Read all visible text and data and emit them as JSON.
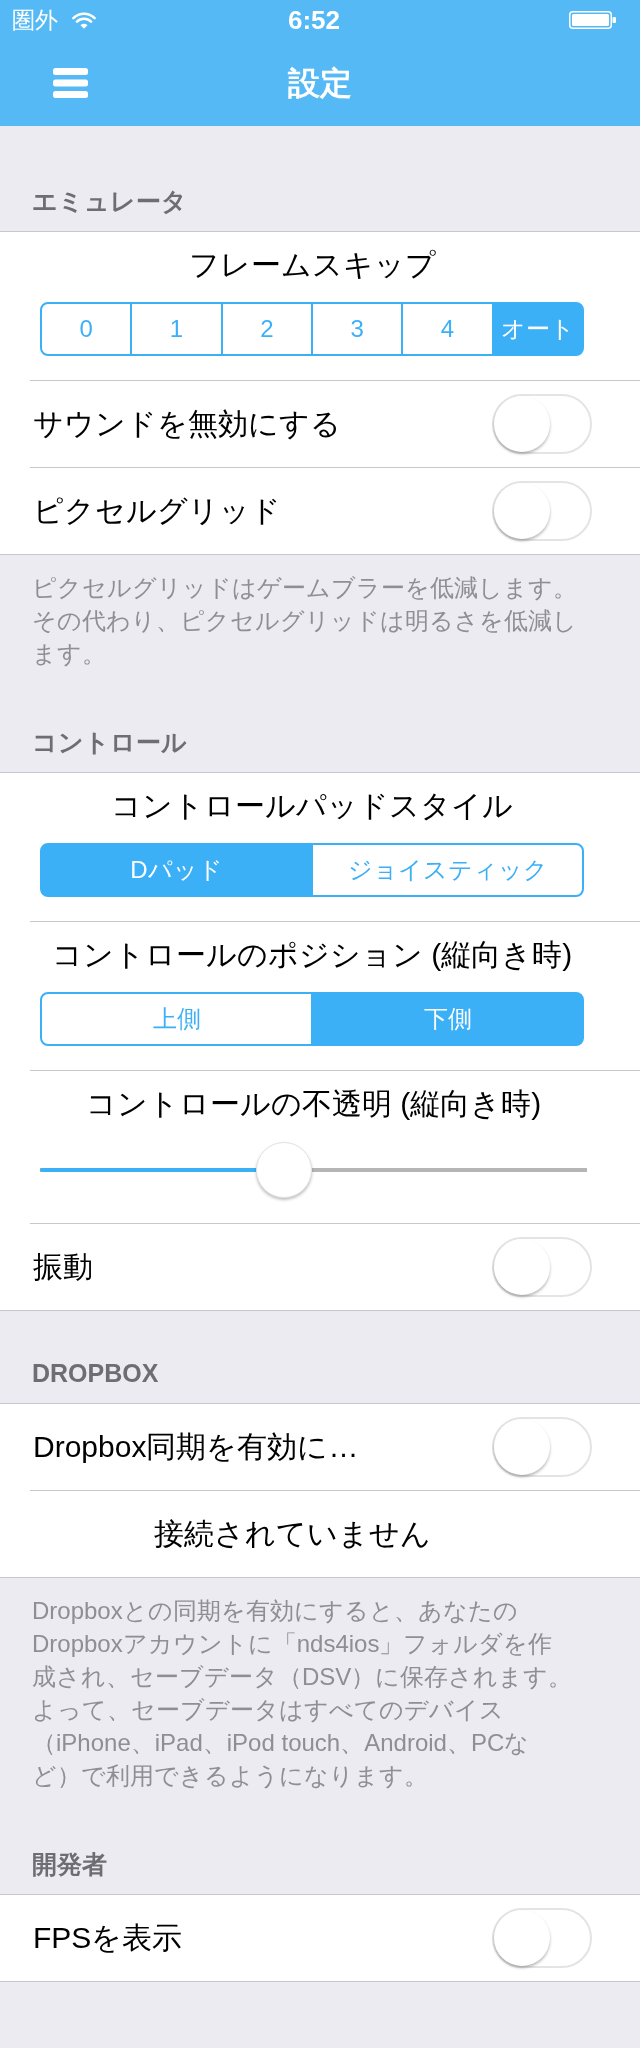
{
  "status_bar": {
    "carrier": "圏外",
    "time": "6:52"
  },
  "nav_bar": {
    "title": "設定"
  },
  "sections": [
    {
      "header": "エミュレータ",
      "rows": [
        {
          "kind": "segmented",
          "title": "フレームスキップ",
          "segments": [
            {
              "label": "0",
              "selected": false
            },
            {
              "label": "1",
              "selected": false
            },
            {
              "label": "2",
              "selected": false
            },
            {
              "label": "3",
              "selected": false
            },
            {
              "label": "4",
              "selected": false
            },
            {
              "label": "オート",
              "selected": true
            }
          ]
        },
        {
          "kind": "toggle",
          "label": "サウンドを無効にする",
          "on": false
        },
        {
          "kind": "toggle",
          "label": "ピクセルグリッド",
          "on": false
        }
      ],
      "footer": "ピクセルグリッドはゲームブラーを低減します。その代わり、ピクセルグリッドは明るさを低減します。"
    },
    {
      "header": "コントロール",
      "rows": [
        {
          "kind": "segmented",
          "title": "コントロールパッドスタイル",
          "segments": [
            {
              "label": "Dパッド",
              "selected": true
            },
            {
              "label": "ジョイスティック",
              "selected": false
            }
          ]
        },
        {
          "kind": "segmented",
          "title": "コントロールのポジション (縦向き時)",
          "segments": [
            {
              "label": "上側",
              "selected": false
            },
            {
              "label": "下側",
              "selected": true
            }
          ]
        },
        {
          "kind": "slider",
          "title": "コントロールの不透明 (縦向き時)",
          "level": 0.44
        },
        {
          "kind": "toggle",
          "label": "振動",
          "on": false
        }
      ]
    },
    {
      "header": "DROPBOX",
      "rows": [
        {
          "kind": "toggle",
          "label": "Dropbox同期を有効に…",
          "on": false
        },
        {
          "kind": "button",
          "label": "接続されていません"
        }
      ],
      "footer": "Dropboxとの同期を有効にすると、あなたのDropboxアカウントに「nds4ios」フォルダを作成され、セーブデータ（DSV）に保存されます。よって、セーブデータはすべてのデバイス（iPhone、iPad、iPod touch、Android、PCなど）で利用できるようになります。"
    },
    {
      "header": "開発者",
      "rows": [
        {
          "kind": "toggle",
          "label": "FPSを表示",
          "on": false
        }
      ]
    }
  ]
}
